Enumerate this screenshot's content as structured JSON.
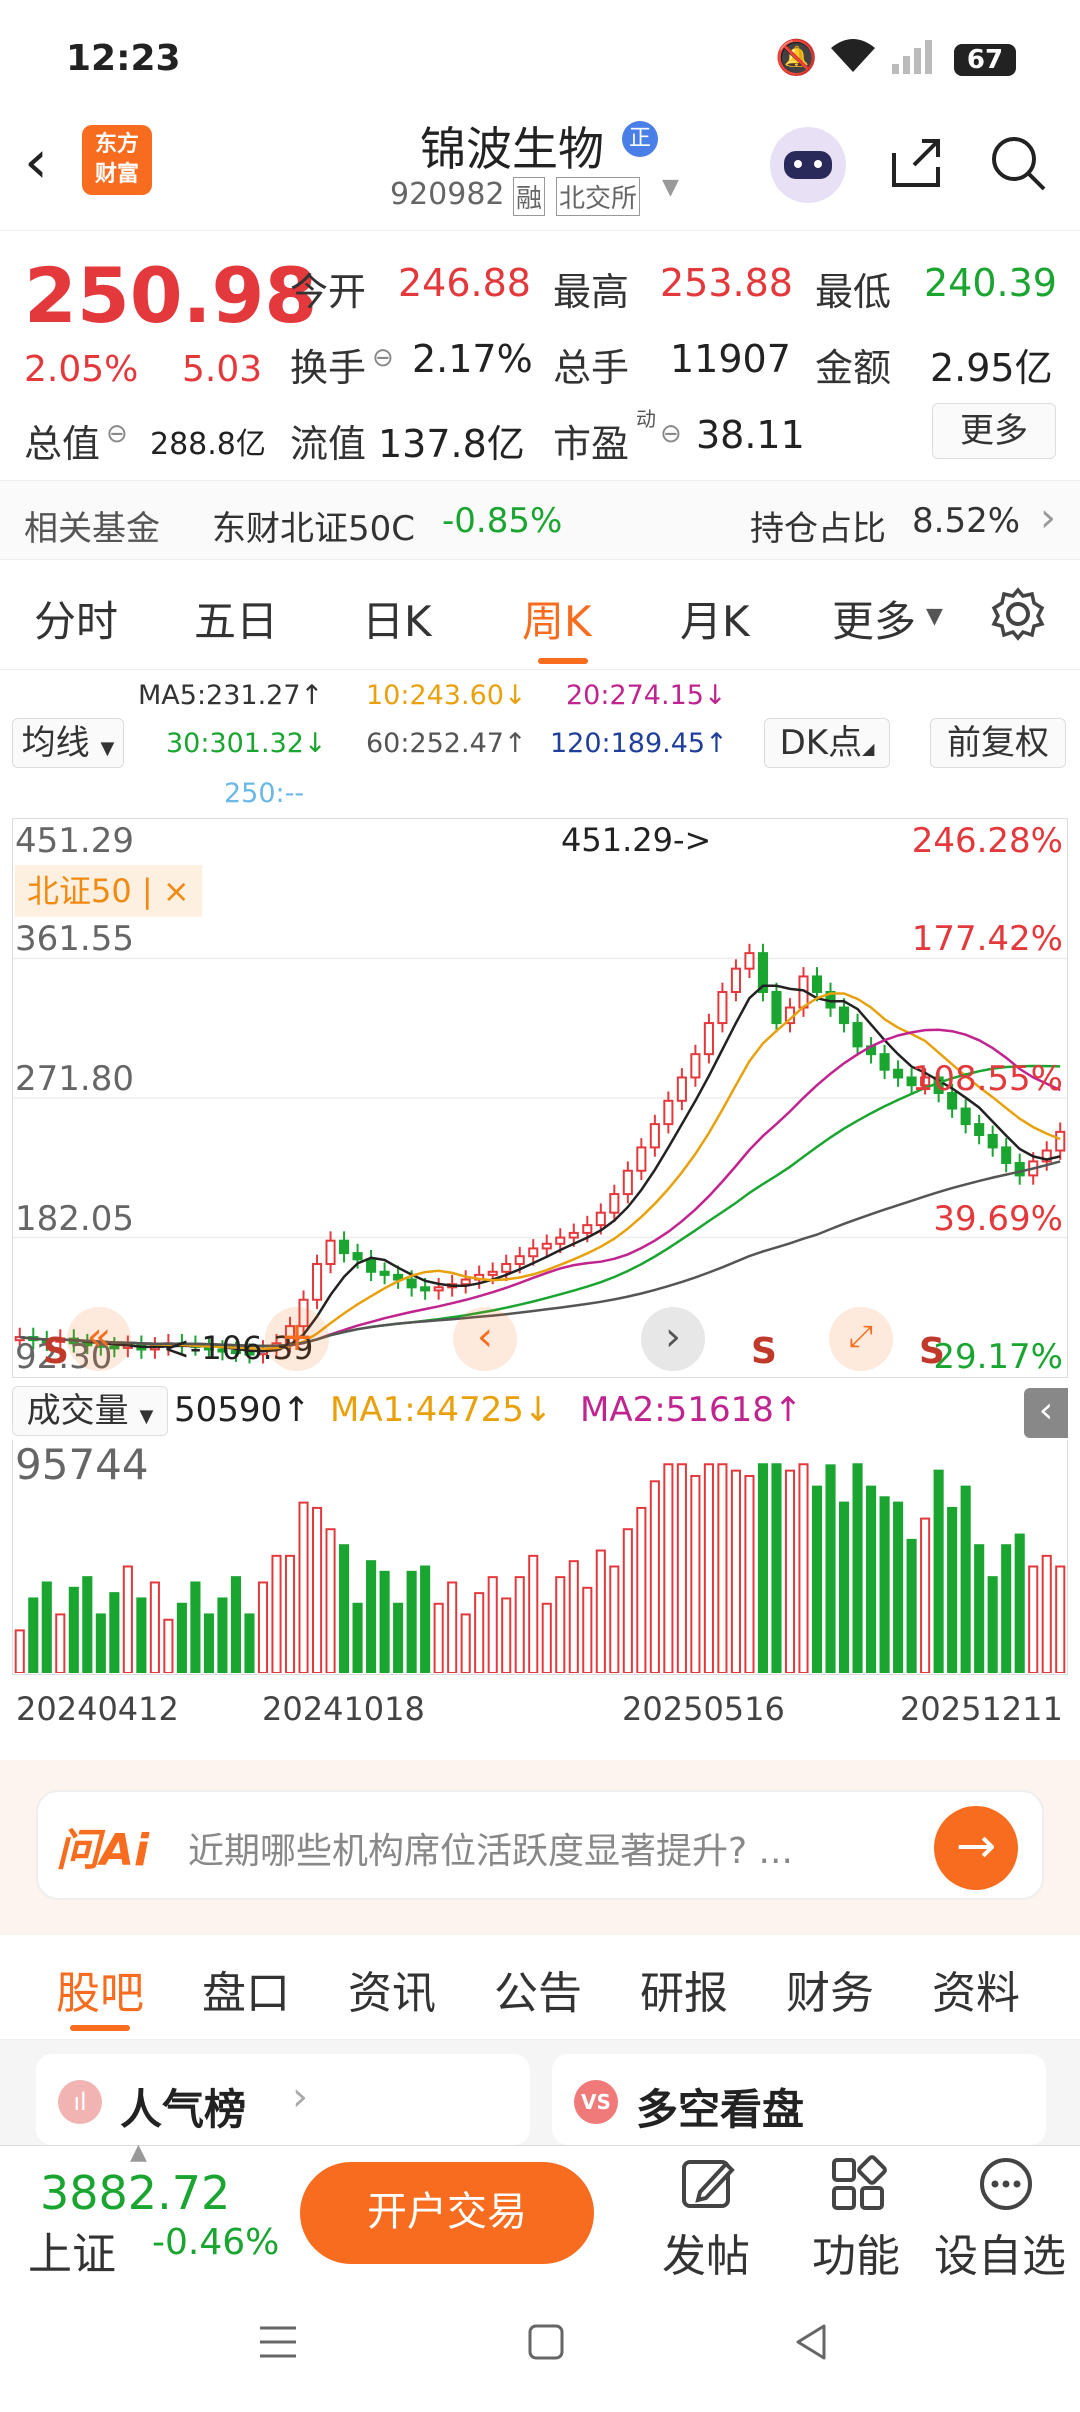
{
  "status": {
    "time": "12:23",
    "battery": "67"
  },
  "header": {
    "logo_line1": "东方",
    "logo_line2": "财富",
    "title": "锦波生物",
    "badge": "正",
    "code": "920982",
    "tag1": "融",
    "tag2": "北交所"
  },
  "quote": {
    "price": "250.98",
    "change_pct": "2.05%",
    "change": "5.03",
    "open_label": "今开",
    "open": "246.88",
    "high_label": "最高",
    "high": "253.88",
    "low_label": "最低",
    "low": "240.39",
    "turnover_label": "换手",
    "turnover": "2.17%",
    "volume_label": "总手",
    "volume": "11907",
    "amount_label": "金额",
    "amount": "2.95亿",
    "mktcap_label": "总值",
    "mktcap": "288.8亿",
    "float_label": "流值",
    "float": "137.8亿",
    "pe_label": "市盈",
    "pe_sup": "动",
    "pe": "38.11",
    "more": "更多"
  },
  "fund": {
    "label": "相关基金",
    "name": "东财北证50C",
    "change": "-0.85%",
    "hold_label": "持仓占比",
    "hold": "8.52%"
  },
  "tabs": [
    "分时",
    "五日",
    "日K",
    "周K",
    "月K",
    "更多"
  ],
  "ma": {
    "selector": "均线",
    "ma5": "MA5:231.27↑",
    "ma10": "10:243.60↓",
    "ma20": "20:274.15↓",
    "ma30": "30:301.32↓",
    "ma60": "60:252.47↑",
    "ma120": "120:189.45↑",
    "ma250": "250:--",
    "dk": "DK点",
    "fq": "前复权"
  },
  "chart": {
    "y_top": "451.29",
    "y2": "361.55",
    "y3": "271.80",
    "y4": "182.05",
    "y_bot": "92.30",
    "pct_top": "246.28%",
    "pct2": "177.42%",
    "pct3": "108.55%",
    "pct4": "39.69%",
    "pct_bot": "29.17%",
    "max_label": "451.29->",
    "min_label": "<-106.39",
    "index_tag": "北证50 | ×",
    "s_mark": "S"
  },
  "chart_data": {
    "type": "candlestick",
    "ylim": [
      92.3,
      451.29
    ],
    "max": 451.29,
    "min": 106.39,
    "closes": [
      118,
      116,
      115,
      117,
      114,
      113,
      112,
      111,
      113,
      110,
      112,
      114,
      113,
      112,
      110,
      109,
      108,
      107,
      110,
      114,
      125,
      142,
      165,
      180,
      172,
      168,
      160,
      158,
      155,
      150,
      148,
      150,
      152,
      155,
      158,
      160,
      165,
      170,
      175,
      178,
      182,
      185,
      190,
      198,
      210,
      225,
      240,
      255,
      270,
      285,
      300,
      320,
      340,
      355,
      365,
      340,
      320,
      330,
      350,
      340,
      330,
      320,
      305,
      300,
      290,
      285,
      280,
      285,
      275,
      265,
      255,
      248,
      240,
      230,
      222,
      231,
      238,
      250
    ],
    "volume_max": 95744,
    "volume": {
      "value": "50590↑",
      "ma1": "MA1:44725↓",
      "ma2": "MA2:51618↑"
    },
    "dates": [
      "20240412",
      "20241018",
      "20250516",
      "20251211"
    ]
  },
  "volume": {
    "selector": "成交量",
    "value": "50590↑",
    "ma1": "MA1:44725↓",
    "ma2": "MA2:51618↑",
    "max": "95744"
  },
  "ai": {
    "logo": "问Ai",
    "prompt": "近期哪些机构席位活跃度显著提升? ..."
  },
  "bottom_tabs": [
    "股吧",
    "盘口",
    "资讯",
    "公告",
    "研报",
    "财务",
    "资料"
  ],
  "cards": {
    "left": "人气榜",
    "right": "多空看盘"
  },
  "footer": {
    "index_value": "3882.72",
    "index_name": "上证",
    "index_change": "-0.46%",
    "trade": "开户交易",
    "post": "发帖",
    "func": "功能",
    "watch": "设自选"
  },
  "colors": {
    "up": "#e4393c",
    "down": "#1aa531",
    "accent": "#f76c1e"
  }
}
